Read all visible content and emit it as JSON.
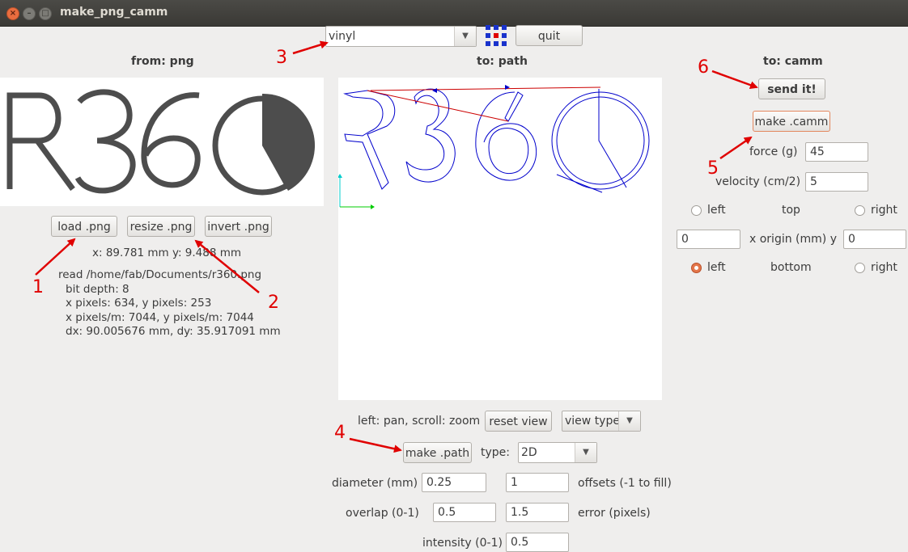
{
  "window": {
    "title": "make_png_camm"
  },
  "toolbar": {
    "material": "vinyl",
    "quit_label": "quit"
  },
  "left": {
    "header": "from: png",
    "load_label": "load .png",
    "resize_label": "resize .png",
    "invert_label": "invert .png",
    "xy_readout": "x: 89.781 mm  y: 9.488 mm",
    "info": [
      "read /home/fab/Documents/r360.png",
      "bit depth: 8",
      "x pixels: 634, y pixels: 253",
      "x pixels/m: 7044, y pixels/m: 7044",
      "dx: 90.005676 mm, dy: 35.917091 mm"
    ]
  },
  "middle": {
    "header": "to: path",
    "pan_hint": "left: pan, scroll: zoom",
    "reset_label": "reset view",
    "view_type": "view type",
    "make_path_label": "make .path",
    "type_label": "type:",
    "type_value": "2D",
    "diameter_label": "diameter (mm)",
    "diameter_value": "0.25",
    "offsets_value": "1",
    "offsets_label": "offsets (-1 to fill)",
    "overlap_label": "overlap (0-1)",
    "overlap_value": "0.5",
    "error_value": "1.5",
    "error_label": "error (pixels)",
    "intensity_label": "intensity (0-1)",
    "intensity_value": "0.5"
  },
  "right": {
    "header": "to: camm",
    "send_label": "send it!",
    "make_camm_label": "make .camm",
    "force_label": "force (g)",
    "force_value": "45",
    "velocity_label": "velocity (cm/2)",
    "velocity_value": "5",
    "left_label": "left",
    "top_label": "top",
    "right_label": "right",
    "origin_x": "0",
    "origin_label": "x  origin (mm)  y",
    "origin_y": "0",
    "left2_label": "left",
    "bottom_label": "bottom",
    "right2_label": "right"
  },
  "annotations": [
    "1",
    "2",
    "3",
    "4",
    "5",
    "6"
  ],
  "colors": {
    "accent": "#e4764a",
    "annotation": "#e00000",
    "path": "#0000cc"
  }
}
